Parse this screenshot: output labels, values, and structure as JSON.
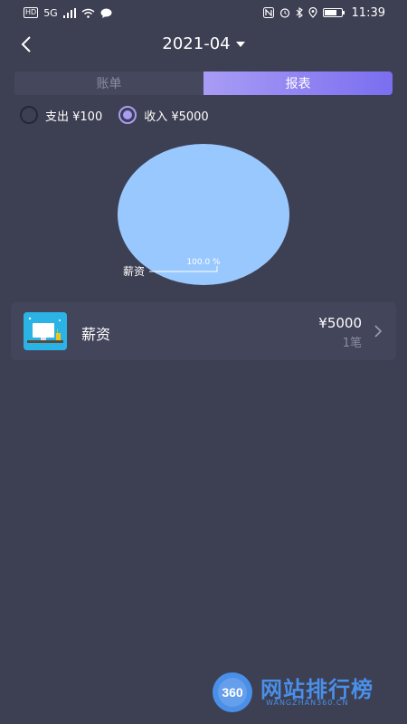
{
  "status_bar": {
    "left_badge": "HD",
    "network": "5G",
    "time": "11:39",
    "battery_level": 0.75
  },
  "header": {
    "month": "2021-04"
  },
  "tabs": [
    {
      "label": "账单",
      "active": false
    },
    {
      "label": "报表",
      "active": true
    }
  ],
  "filters": [
    {
      "label": "支出 ¥100",
      "checked": false
    },
    {
      "label": "收入 ¥5000",
      "checked": true
    }
  ],
  "chart_data": {
    "type": "pie",
    "slices": [
      {
        "label": "薪资",
        "value": 100.0,
        "percent_label": "100.0 %",
        "color": "#99c8ff"
      }
    ]
  },
  "categories": [
    {
      "name": "薪资",
      "amount": "¥5000",
      "count": "1笔",
      "icon": "salary-desk-icon"
    }
  ],
  "watermark": {
    "logo_text": "360",
    "title": "网站排行榜",
    "subtitle": "WANGZHAN360.CN"
  },
  "colors": {
    "background": "#3d3f52",
    "accent": "#a89cf5",
    "pie": "#99c8ff",
    "watermark": "#4a8fe8"
  }
}
